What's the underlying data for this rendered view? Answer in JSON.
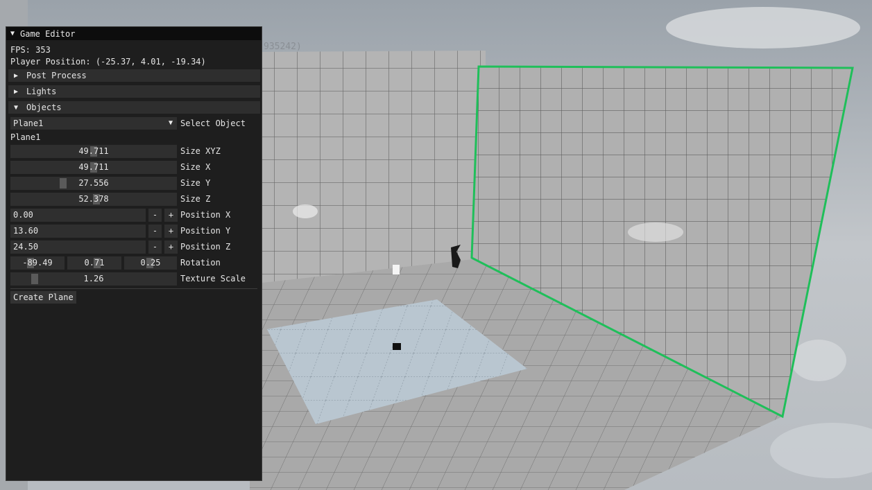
{
  "viewport": {
    "overlay_text": "935242)"
  },
  "editor": {
    "title": "Game Editor",
    "fps_line": "FPS: 353",
    "player_position_line": "Player Position: (-25.37, 4.01, -19.34)",
    "sections": {
      "post_process": "Post Process",
      "lights": "Lights",
      "objects": "Objects"
    },
    "select_object": {
      "value": "Plane1",
      "label": "Select Object"
    },
    "object_name": "Plane1",
    "size_xyz": {
      "value": "49.711",
      "label": "Size XYZ"
    },
    "size_x": {
      "value": "49.711",
      "label": "Size X"
    },
    "size_y": {
      "value": "27.556",
      "label": "Size Y"
    },
    "size_z": {
      "value": "52.378",
      "label": "Size Z"
    },
    "position_x": {
      "value": "0.00",
      "label": "Position X"
    },
    "position_y": {
      "value": "13.60",
      "label": "Position Y"
    },
    "position_z": {
      "value": "24.50",
      "label": "Position Z"
    },
    "minus": "-",
    "plus": "+",
    "rotation": {
      "x": "-89.49",
      "y": "0.71",
      "z": "0.25",
      "label": "Rotation"
    },
    "texture_scale": {
      "value": "1.26",
      "label": "Texture Scale"
    },
    "create_plane_label": "Create Plane"
  },
  "colors": {
    "selection_outline": "#1fbf5a",
    "panel_bg": "#1e1e1e",
    "title_bg": "#0d0d0d",
    "header_bg": "#2e2e2e",
    "frame_bg": "#2f2f2f"
  }
}
